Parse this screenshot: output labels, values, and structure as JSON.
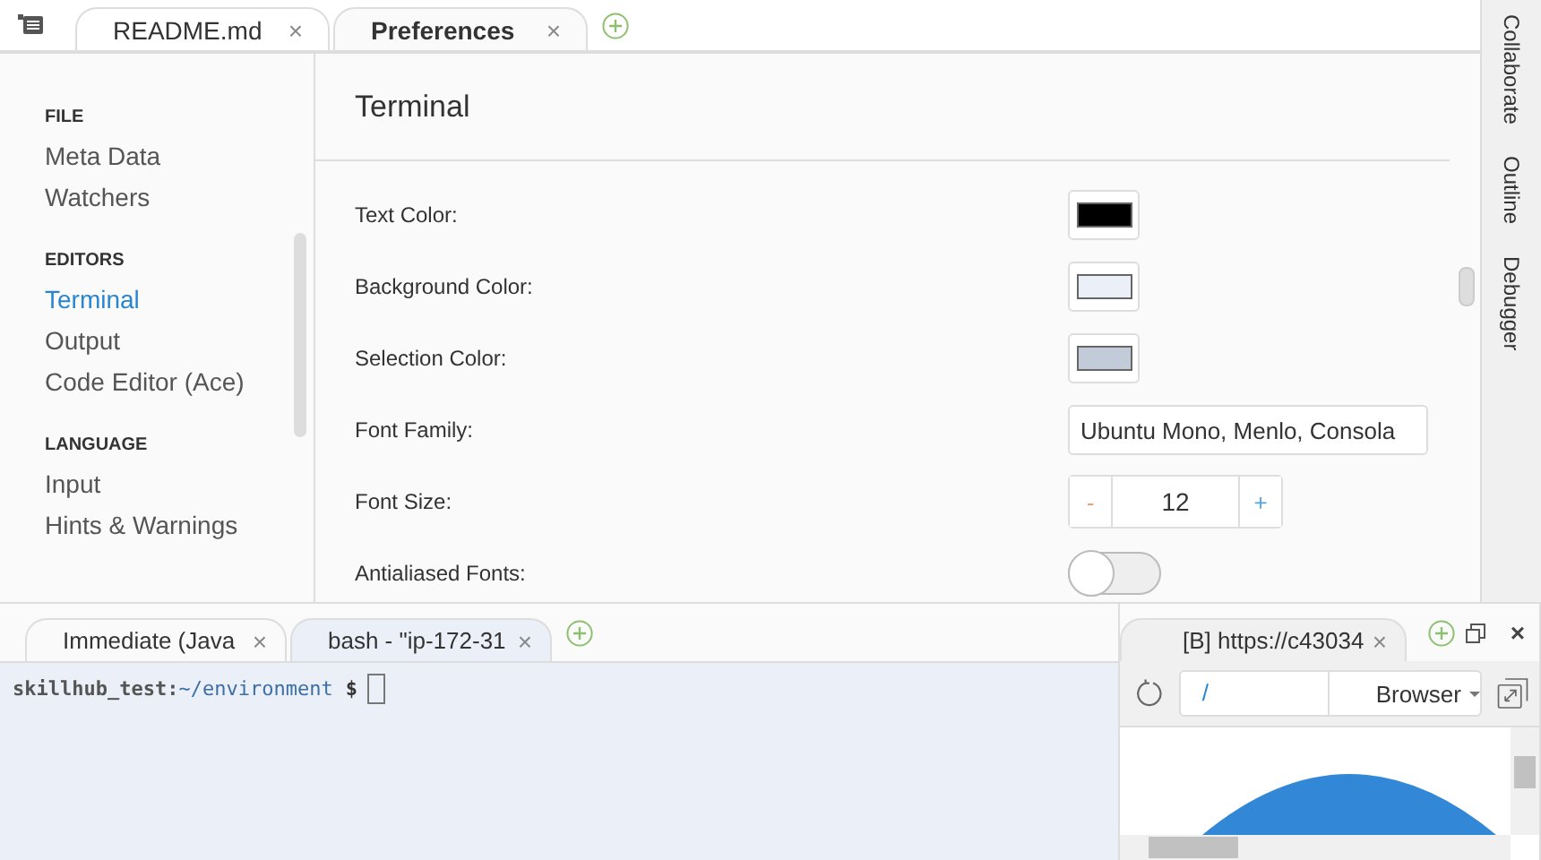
{
  "editor_tabs": [
    {
      "label": "README.md",
      "close": "×",
      "selected": false
    },
    {
      "label": "Preferences",
      "close": "×",
      "selected": true
    }
  ],
  "sidebar": {
    "sections": [
      {
        "heading": "FILE",
        "items": [
          {
            "label": "Meta Data",
            "selected": false
          },
          {
            "label": "Watchers",
            "selected": false
          }
        ]
      },
      {
        "heading": "EDITORS",
        "items": [
          {
            "label": "Terminal",
            "selected": true
          },
          {
            "label": "Output",
            "selected": false
          },
          {
            "label": "Code Editor (Ace)",
            "selected": false
          }
        ]
      },
      {
        "heading": "LANGUAGE",
        "items": [
          {
            "label": "Input",
            "selected": false
          },
          {
            "label": "Hints & Warnings",
            "selected": false
          }
        ]
      }
    ]
  },
  "content": {
    "title": "Terminal",
    "settings": [
      {
        "kind": "color",
        "label": "Text Color:",
        "color": "#000000"
      },
      {
        "kind": "color",
        "label": "Background Color:",
        "color": "#ebeff7"
      },
      {
        "kind": "color",
        "label": "Selection Color:",
        "color": "#c1ccd8"
      },
      {
        "kind": "text",
        "label": "Font Family:",
        "value": "Ubuntu Mono, Menlo, Consola"
      },
      {
        "kind": "stepper",
        "label": "Font Size:",
        "value": "12",
        "minus": "-",
        "plus": "+"
      },
      {
        "kind": "toggle",
        "label": "Antialiased Fonts:",
        "on": false
      }
    ]
  },
  "right_panel": [
    "Collaborate",
    "Outline",
    "Debugger"
  ],
  "terminal": {
    "tabs": [
      {
        "label": "Immediate (Java",
        "close": "×",
        "selected": false
      },
      {
        "label": "bash - \"ip-172-31",
        "close": "×",
        "selected": true
      }
    ],
    "prompt_user": "skillhub_test:",
    "prompt_path": "~/environment",
    "prompt_sign": "$"
  },
  "browser": {
    "tab": {
      "label": "[B] https://c43034",
      "close": "×"
    },
    "close": "×",
    "address": "/",
    "mode": "Browser"
  }
}
